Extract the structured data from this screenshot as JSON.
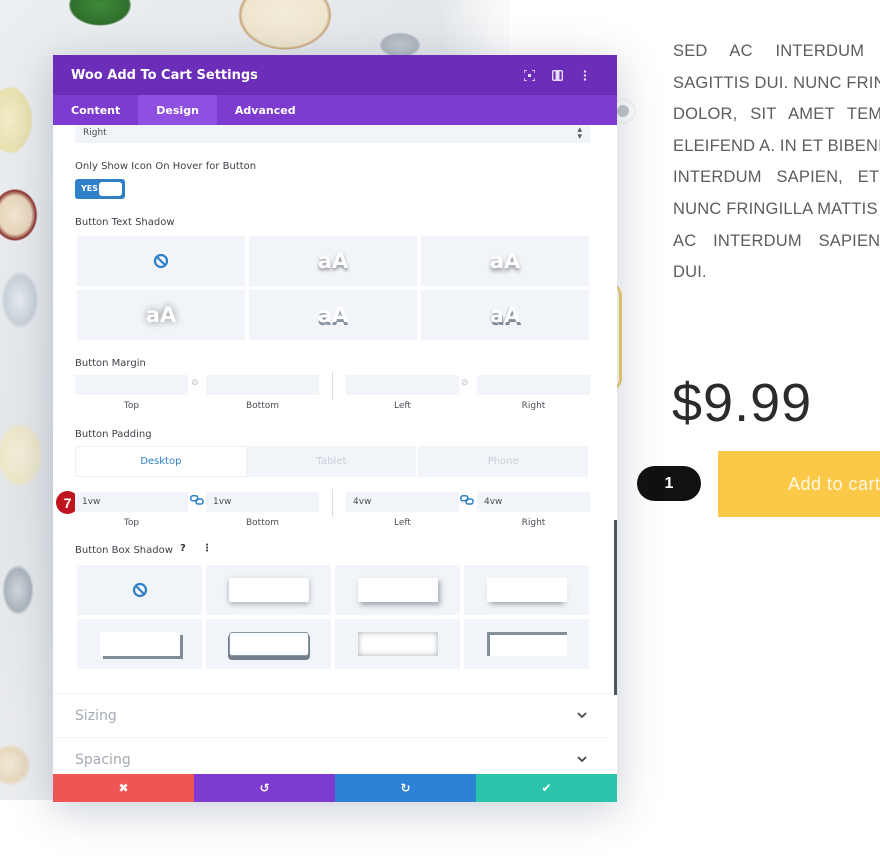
{
  "modal": {
    "title": "Woo Add To Cart Settings",
    "header_icons": [
      "expand-icon",
      "sidebar-toggle-icon",
      "more-vertical-icon"
    ],
    "tabs": [
      {
        "label": "Content",
        "active": false
      },
      {
        "label": "Design",
        "active": true
      },
      {
        "label": "Advanced",
        "active": false
      }
    ],
    "alignment_select": {
      "value": "Right"
    },
    "icon_hover": {
      "label": "Only Show Icon On Hover for Button",
      "toggle_label": "YES",
      "value": true
    },
    "text_shadow": {
      "label": "Button Text Shadow",
      "sample_text": "aA",
      "presets": [
        "none",
        "preset-1",
        "preset-2",
        "preset-3",
        "preset-4",
        "preset-5"
      ]
    },
    "button_margin": {
      "label": "Button Margin",
      "top": "",
      "bottom": "",
      "left": "",
      "right": "",
      "captions": {
        "top": "Top",
        "bottom": "Bottom",
        "left": "Left",
        "right": "Right"
      }
    },
    "button_padding": {
      "label": "Button Padding",
      "device_tabs": [
        {
          "label": "Desktop",
          "active": true
        },
        {
          "label": "Tablet",
          "active": false
        },
        {
          "label": "Phone",
          "active": false
        }
      ],
      "top": "1vw",
      "bottom": "1vw",
      "left": "4vw",
      "right": "4vw",
      "captions": {
        "top": "Top",
        "bottom": "Bottom",
        "left": "Left",
        "right": "Right"
      },
      "step_badge": "7"
    },
    "box_shadow": {
      "label": "Button Box Shadow",
      "help": "?",
      "more": "⋮",
      "presets": [
        "none",
        "preset-1",
        "preset-2",
        "preset-3",
        "preset-4",
        "preset-5",
        "preset-6",
        "preset-7"
      ]
    },
    "accordions": [
      {
        "title": "Sizing",
        "expanded": false
      },
      {
        "title": "Spacing",
        "expanded": false
      }
    ],
    "footer": {
      "cancel": "✖",
      "undo": "↺",
      "redo": "↻",
      "save": "✔"
    }
  },
  "product": {
    "description_lines": [
      "SED AC INTERDUM",
      "SAGITTIS DUI. NUNC FRING",
      "DOLOR, SIT AMET TEMP",
      "ELEIFEND A. IN ET BIBENI",
      "INTERDUM SAPIEN, ET S",
      "NUNC FRINGILLA MATTIS",
      "AC INTERDUM SAPIEN,",
      "DUI."
    ],
    "price": "$9.99",
    "quantity": "1",
    "add_to_cart": "Add to cart"
  },
  "colors": {
    "header_purple": "#6c2eb9",
    "tab_purple": "#7e3bd0",
    "accent_blue": "#2f80c9",
    "add_to_cart_yellow": "#fcc847",
    "cancel_red": "#ef5555",
    "save_teal": "#29c4a9",
    "redo_blue": "#2d82d6",
    "badge_red": "#c0141f"
  }
}
